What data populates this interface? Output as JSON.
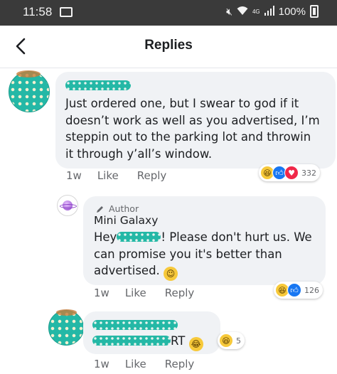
{
  "status_bar": {
    "time": "11:58",
    "network": "4G",
    "battery": "100%",
    "icons": [
      "cast-icon",
      "mute-icon",
      "wifi-icon",
      "signal-icon",
      "battery-icon"
    ]
  },
  "header": {
    "title": "Replies",
    "back_icon": "chevron-left-icon"
  },
  "comments": [
    {
      "author_redacted": true,
      "text_lines": [
        "Just ordered one, but I swear to god if it",
        "doesn’t work as well as you advertised, I’m",
        "steppin out to the parking lot and throwin",
        "it through y’all’s window."
      ],
      "time": "1w",
      "like_label": "Like",
      "reply_label": "Reply",
      "reactions": [
        "haha",
        "like",
        "love"
      ],
      "reaction_count": "332"
    },
    {
      "author_tag": "Author",
      "author_name": "Mini Galaxy",
      "text_line1_pre": "Hey",
      "text_line1_post": "! Please don't hurt us. We",
      "text_line2": "can promise you it's better than",
      "text_line3": "advertised.",
      "time": "1w",
      "like_label": "Like",
      "reply_label": "Reply",
      "reactions": [
        "haha",
        "like"
      ],
      "reaction_count": "126"
    },
    {
      "author_redacted": true,
      "text_suffix": "RT",
      "time": "1w",
      "like_label": "Like",
      "reply_label": "Reply",
      "reactions": [
        "haha"
      ],
      "reaction_count": "5"
    }
  ],
  "colors": {
    "accent": "#1877f2",
    "bubble": "#f0f2f5",
    "meta_text": "#65676b",
    "status_bar": "#3a3a3a"
  }
}
